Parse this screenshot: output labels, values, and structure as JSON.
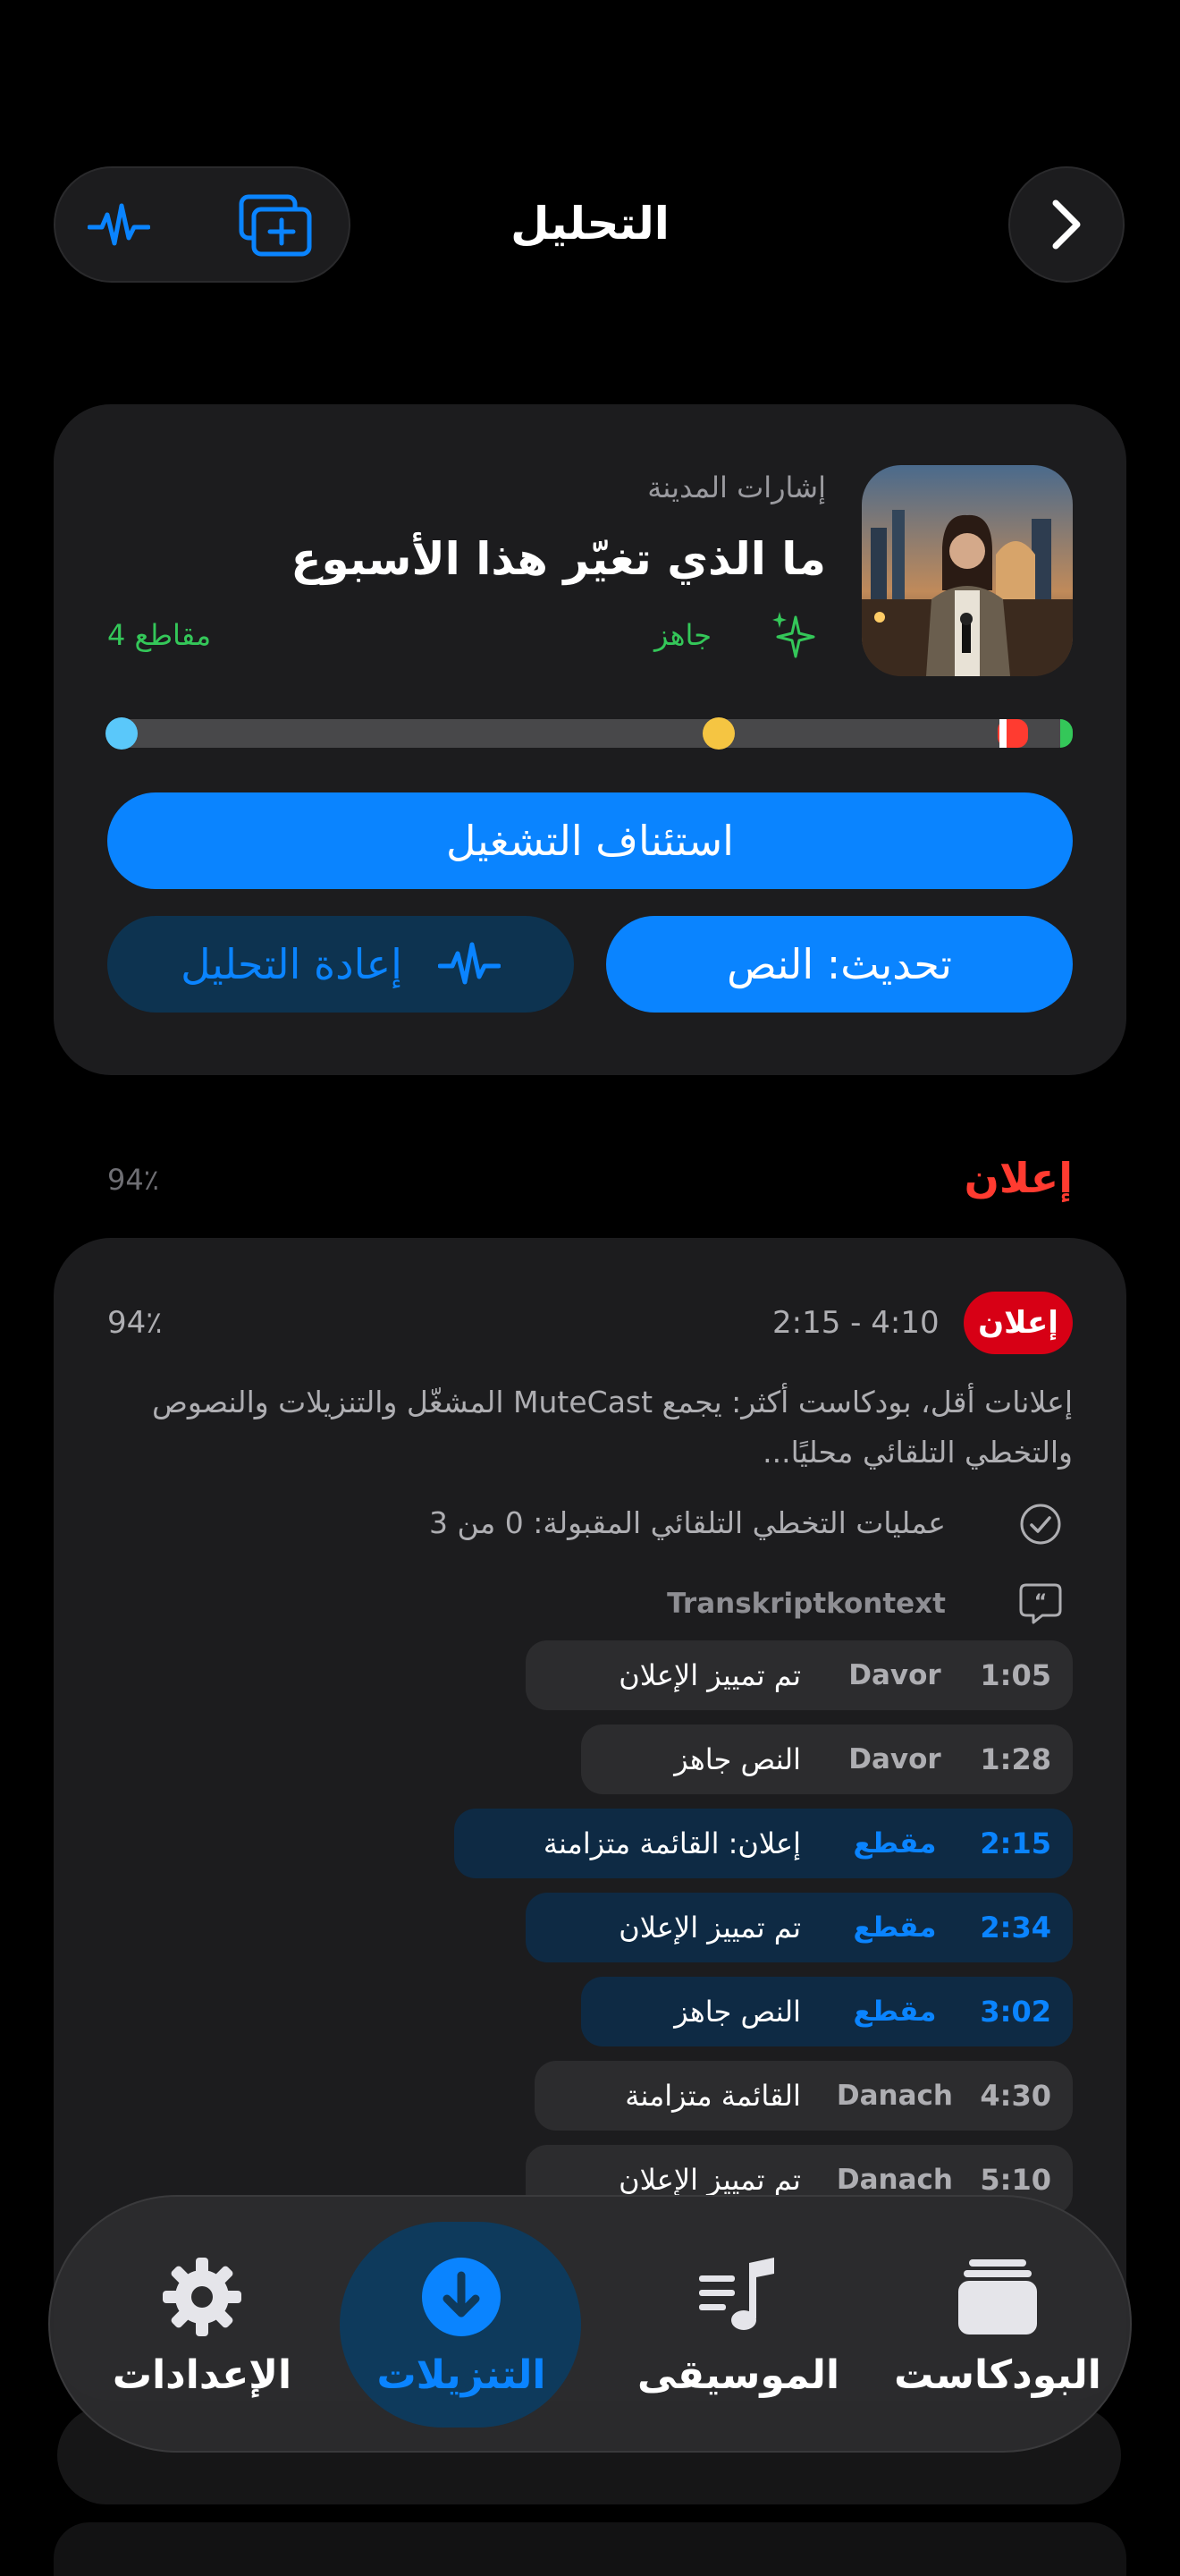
{
  "header": {
    "title": "التحليل",
    "left_icons": [
      "waveform-icon",
      "add-to-library-icon"
    ],
    "right_icon": "chevron-right-icon"
  },
  "episode": {
    "podcast_name": "إشارات المدينة",
    "title": "ما الذي تغيّر هذا الأسبوع",
    "status": "جاهز",
    "segments": "4 مقاطع",
    "timeline": {
      "progress_markers": [
        0.0,
        0.66,
        0.91,
        1.0
      ],
      "colors": {
        "start": "#5ac8fa",
        "mid": "#f5c542",
        "ad": "#ff3b30",
        "end": "#34c759"
      }
    },
    "resume_label": "استئناف التشغيل",
    "transcript_label": "تحديث: النص",
    "reanalyze_label": "إعادة التحليل"
  },
  "section": {
    "title": "إعلان",
    "percent": "94٪"
  },
  "ad": {
    "badge": "إعلان",
    "time_range": "2:15 - 4:10",
    "percent": "94٪",
    "description": "إعلانات أقل، بودكاست أكثر: يجمع MuteCast المشغّل والتنزيلات والنصوص والتخطي التلقائي محليًا...",
    "auto_skips": "عمليات التخطي التلقائي المقبولة: 0 من 3",
    "context_label": "Transkriptkontext",
    "rows": [
      {
        "time": "1:05",
        "speaker": "Davor",
        "text": "تم تمييز الإعلان",
        "highlight": false
      },
      {
        "time": "1:28",
        "speaker": "Davor",
        "text": "النص جاهز",
        "highlight": false
      },
      {
        "time": "2:15",
        "speaker": "مقطع",
        "text": "إعلان: القائمة متزامنة",
        "highlight": true
      },
      {
        "time": "2:34",
        "speaker": "مقطع",
        "text": "تم تمييز الإعلان",
        "highlight": true
      },
      {
        "time": "3:02",
        "speaker": "مقطع",
        "text": "النص جاهز",
        "highlight": true
      },
      {
        "time": "4:30",
        "speaker": "Danach",
        "text": "القائمة متزامنة",
        "highlight": false
      },
      {
        "time": "5:10",
        "speaker": "Danach",
        "text": "تم تمييز الإعلان",
        "highlight": false
      }
    ]
  },
  "tabbar": {
    "tabs": [
      {
        "label": "البودكاست",
        "icon": "stack-icon"
      },
      {
        "label": "الموسيقى",
        "icon": "music-list-icon"
      },
      {
        "label": "التنزيلات",
        "icon": "download-icon",
        "active": true
      },
      {
        "label": "الإعدادات",
        "icon": "gear-icon"
      }
    ]
  },
  "colors": {
    "accent": "#0a84ff",
    "ad": "#ff3b30",
    "ready": "#34c759"
  }
}
